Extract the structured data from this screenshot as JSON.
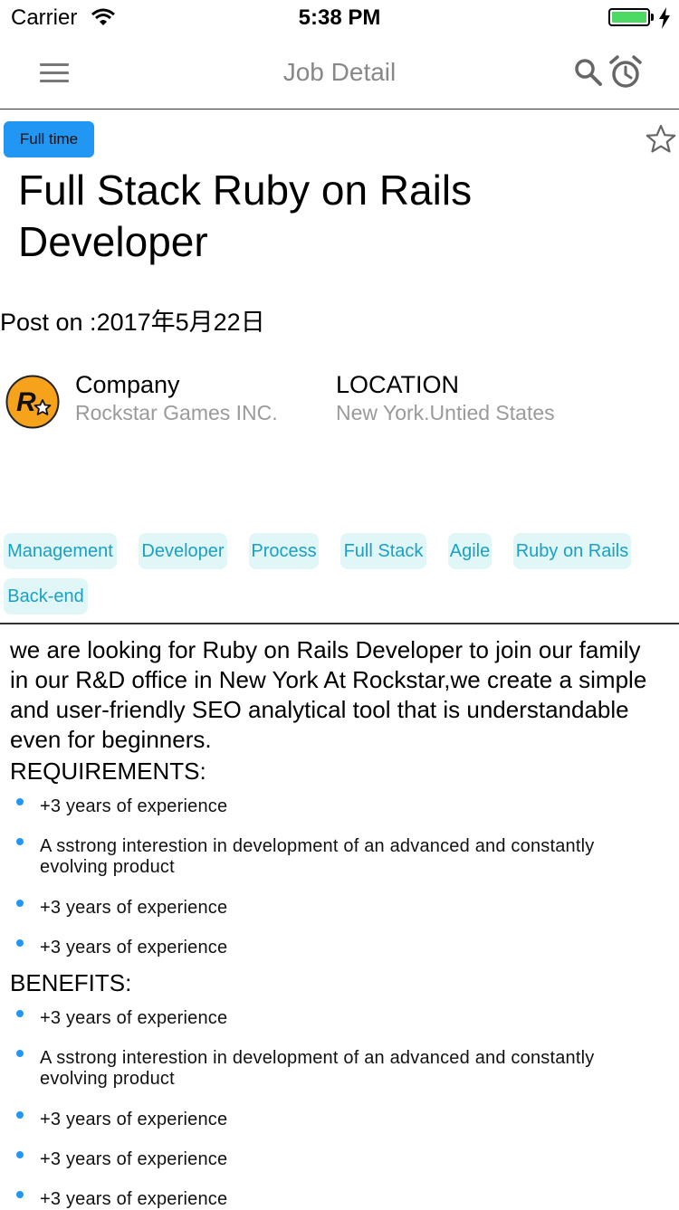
{
  "status_bar": {
    "carrier": "Carrier",
    "time": "5:38 PM"
  },
  "nav": {
    "title": "Job Detail"
  },
  "job": {
    "employment_type": "Full time",
    "title": "Full Stack Ruby on Rails Developer",
    "post_label": "Post on :",
    "post_date": "2017年5月22日"
  },
  "company": {
    "label": "Company",
    "name": "Rockstar Games INC.",
    "location_label": "LOCATION",
    "location": "New York.Untied States"
  },
  "tags": [
    "Management",
    "Developer",
    "Process",
    "Full Stack",
    "Agile",
    "Ruby on Rails",
    "Back-end"
  ],
  "description": "we are looking for Ruby on Rails Developer to join our family in our R&D office in New York At Rockstar,we create a simple and user-friendly SEO analytical tool that is understandable even for beginners.",
  "requirements": {
    "heading": "REQUIREMENTS:",
    "items": [
      "+3 years of experience",
      "A sstrong interestion in development of an advanced and constantly evolving product",
      "+3 years of experience",
      "+3 years of experience"
    ]
  },
  "benefits": {
    "heading": "BENEFITS:",
    "items": [
      "+3 years of experience",
      "A sstrong interestion in development of an advanced and constantly evolving product",
      "+3 years of experience",
      "+3 years of experience",
      "+3 years of experience"
    ]
  },
  "colors": {
    "accent": "#2196f3",
    "tag_bg": "#e1f7f7",
    "tag_text": "#1aa0c4",
    "logo_bg": "#f7a21b"
  },
  "icons": [
    "wifi-icon",
    "battery-icon",
    "menu-icon",
    "search-icon",
    "alarm-clock-icon",
    "star-outline-icon",
    "rockstar-logo"
  ]
}
